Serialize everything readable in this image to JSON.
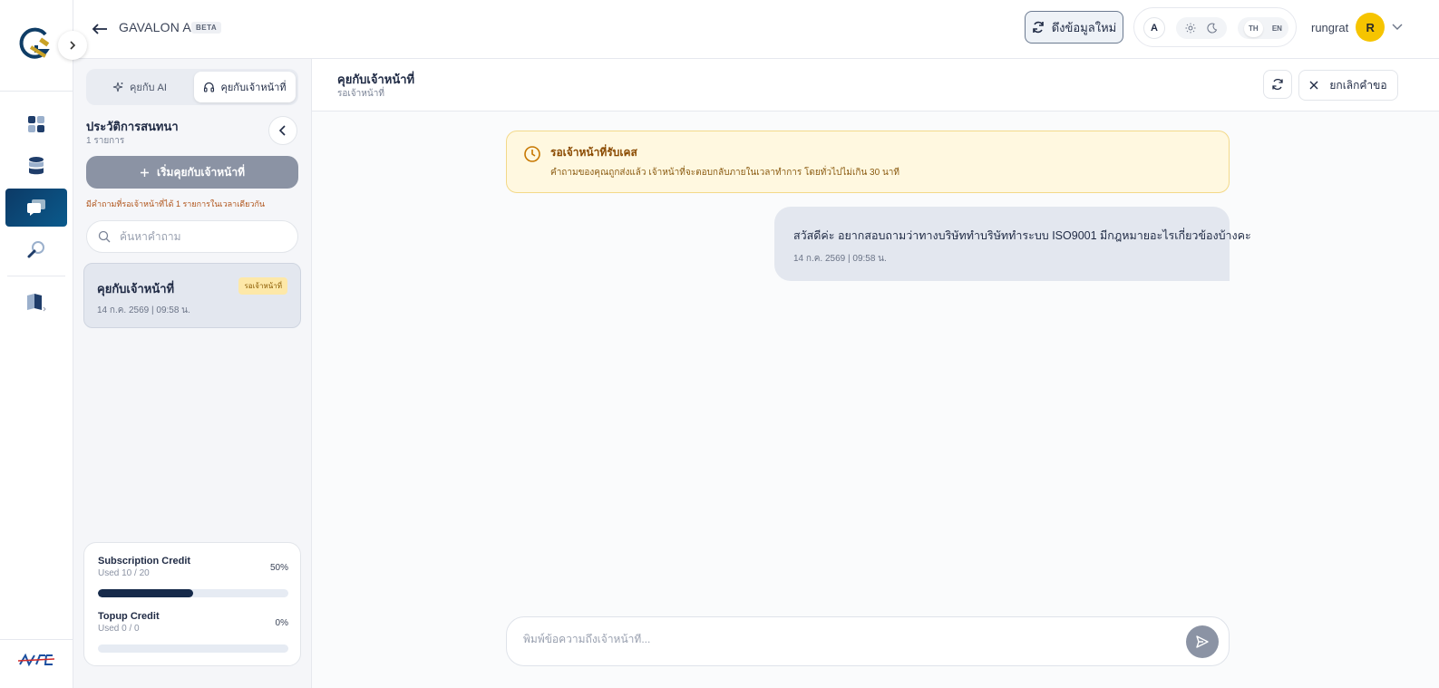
{
  "app": {
    "brand": "GAVALON AI",
    "beta": "BETA"
  },
  "topbar": {
    "refresh_label": "ดึงข้อมูลใหม่",
    "font_toggle": "A",
    "lang_th": "TH",
    "lang_en": "EN",
    "active_lang": "TH",
    "user_name": "rungrat",
    "avatar_letter": "R"
  },
  "sidebar": {
    "tab_ai": "คุยกับ AI",
    "tab_staff": "คุยกับเจ้าหน้าที่",
    "active_tab": "staff",
    "history_title": "ประวัติการสนทนา",
    "history_count": "1 รายการ",
    "new_chat_label": "เริ่มคุยกับเจ้าหน้าที่",
    "limit_note": "มีคำถามที่รอเจ้าหน้าที่ได้ 1 รายการในเวลาเดียวกัน",
    "search_placeholder": "ค้นหาคำถาม",
    "conversations": [
      {
        "title": "คุยกับเจ้าหน้าที่",
        "status": "รอเจ้าหน้าที่",
        "datetime": "14 ก.ค. 2569 | 09:58 น."
      }
    ],
    "credits": [
      {
        "label": "Subscription Credit",
        "used": "Used 10 / 20",
        "percent_text": "50%",
        "fraction": 0.5
      },
      {
        "label": "Topup Credit",
        "used": "Used 0 / 0",
        "percent_text": "0%",
        "fraction": 0
      }
    ]
  },
  "main": {
    "title": "คุยกับเจ้าหน้าที่",
    "subtitle": "รอเจ้าหน้าที่",
    "cancel_label": "ยกเลิกคำขอ",
    "waiting_title": "รอเจ้าหน้าที่รับเคส",
    "waiting_desc": "คำถามของคุณถูกส่งแล้ว เจ้าหน้าที่จะตอบกลับภายในเวลาทำการ โดยทั่วไปไม่เกิน 30 นาที",
    "messages": [
      {
        "text": "สวัสดีค่ะ อยากสอบถามว่าทางบริษัททำบริษัททำระบบ ISO9001 มีกฎหมายอะไรเกี่ยวข้องบ้างคะ",
        "time": "14 ก.ค. 2569 | 09:58 น."
      }
    ],
    "composer_placeholder": "พิมพ์ข้อความถึงเจ้าหน้าที่..."
  },
  "colors": {
    "accent": "#0d3a66",
    "avatar": "#f6c400",
    "warning_bg": "#fff8e0",
    "bubble_bg": "#e3e7ef"
  }
}
